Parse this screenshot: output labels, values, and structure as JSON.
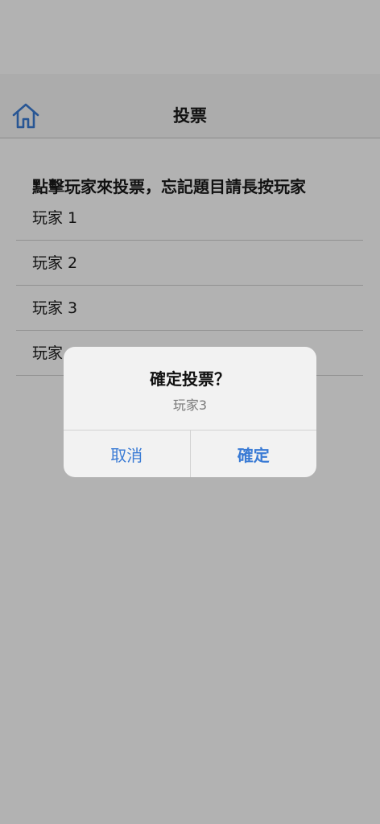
{
  "nav": {
    "title": "投票",
    "home_icon": "home-icon"
  },
  "content": {
    "instruction": "點擊玩家來投票，忘記題目請長按玩家",
    "players": [
      {
        "label": "玩家 1"
      },
      {
        "label": "玩家 2"
      },
      {
        "label": "玩家 3"
      },
      {
        "label": "玩家 4"
      }
    ]
  },
  "alert": {
    "title": "確定投票？",
    "message": "玩家3",
    "cancel_label": "取消",
    "confirm_label": "確定"
  },
  "colors": {
    "accent": "#3a7bd5",
    "overlay": "rgba(0,0,0,0.30)",
    "alert_background": "#f2f2f2"
  }
}
